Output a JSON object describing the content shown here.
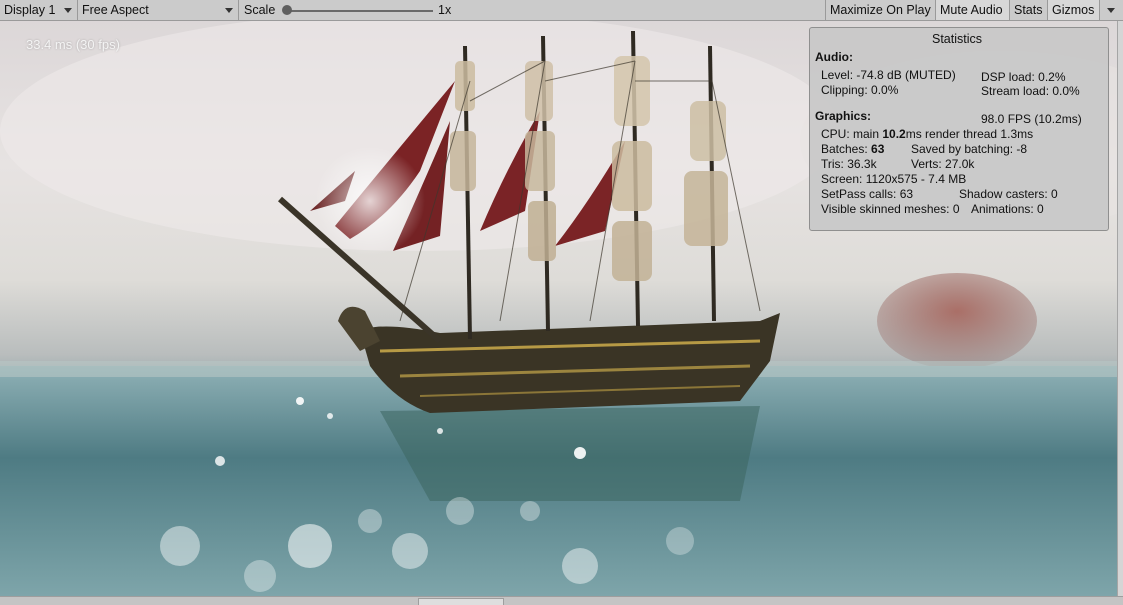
{
  "toolbar": {
    "display": "Display 1",
    "aspect": "Free Aspect",
    "scale_label": "Scale",
    "scale_value": "1x",
    "maximize_on_play": "Maximize On Play",
    "mute_audio": "Mute Audio",
    "stats": "Stats",
    "gizmos": "Gizmos"
  },
  "viewport": {
    "fps_readout": "33.4 ms (30 fps)"
  },
  "stats": {
    "title": "Statistics",
    "audio_header": "Audio:",
    "level": "Level: -74.8 dB (MUTED)",
    "clipping": "Clipping: 0.0%",
    "dsp_load": "DSP load: 0.2%",
    "stream_load": "Stream load: 0.0%",
    "graphics_header": "Graphics:",
    "fps": "98.0 FPS (10.2ms)",
    "cpu_prefix": "CPU: main ",
    "cpu_main": "10.2",
    "cpu_suffix": "ms  render thread 1.3ms",
    "batches_prefix": "Batches: ",
    "batches": "63",
    "saved_batching": "Saved by batching: -8",
    "tris": "Tris: 36.3k",
    "verts": "Verts: 27.0k",
    "screen": "Screen: 1120x575 - 7.4 MB",
    "setpass": "SetPass calls: 63",
    "shadow_casters": "Shadow casters: 0",
    "skinned_meshes": "Visible skinned meshes: 0",
    "animations": "Animations: 0"
  },
  "colors": {
    "toolbar_bg": "#cbcbcb",
    "stats_bg": "#c8c8c8",
    "sail_red": "#7b2325",
    "sea": "#58818a"
  }
}
